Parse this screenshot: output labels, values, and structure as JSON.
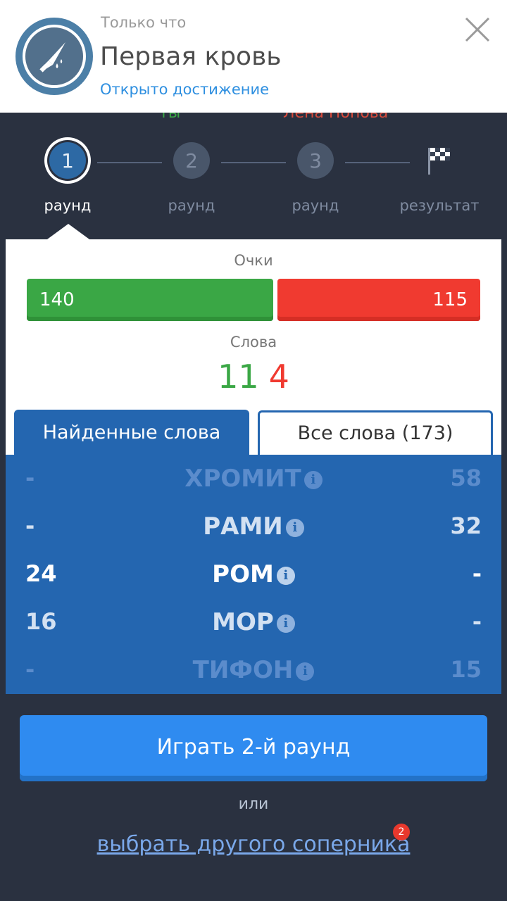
{
  "notification": {
    "time": "Только что",
    "title": "Первая кровь",
    "subtitle": "Открыто достижение",
    "badge_icon": "bloody-knife-icon",
    "close_icon": "close-icon"
  },
  "peek": {
    "left": "ты",
    "right": "Лена Попова"
  },
  "stepper": {
    "steps": [
      {
        "number": "1",
        "label": "раунд",
        "active": true
      },
      {
        "number": "2",
        "label": "раунд",
        "active": false
      },
      {
        "number": "3",
        "label": "раунд",
        "active": false
      },
      {
        "number": "",
        "label": "результат",
        "icon": "checkered-flag-icon",
        "active": false
      }
    ]
  },
  "score": {
    "points_label": "Очки",
    "player_points": "140",
    "opponent_points": "115",
    "words_label": "Слова",
    "player_words": "11",
    "opponent_words": "4",
    "player_color": "#3aa745",
    "opponent_color": "#f03a30"
  },
  "tabs": {
    "found_label": "Найденные слова",
    "all_label": "Все слова (173)"
  },
  "words": [
    {
      "left": "-",
      "word": "ХРОМИТ",
      "right": "58"
    },
    {
      "left": "-",
      "word": "РАМИ",
      "right": "32"
    },
    {
      "left": "24",
      "word": "РОМ",
      "right": "-"
    },
    {
      "left": "16",
      "word": "МОР",
      "right": "-"
    },
    {
      "left": "-",
      "word": "ТИФОН",
      "right": "15"
    }
  ],
  "actions": {
    "play_label": "Играть 2-й раунд",
    "or_label": "или",
    "choose_label": "выбрать другого соперника",
    "choose_badge": "2"
  },
  "colors": {
    "background": "#2a3140",
    "accent_blue": "#2466b0",
    "button_blue": "#2f8bf0"
  }
}
